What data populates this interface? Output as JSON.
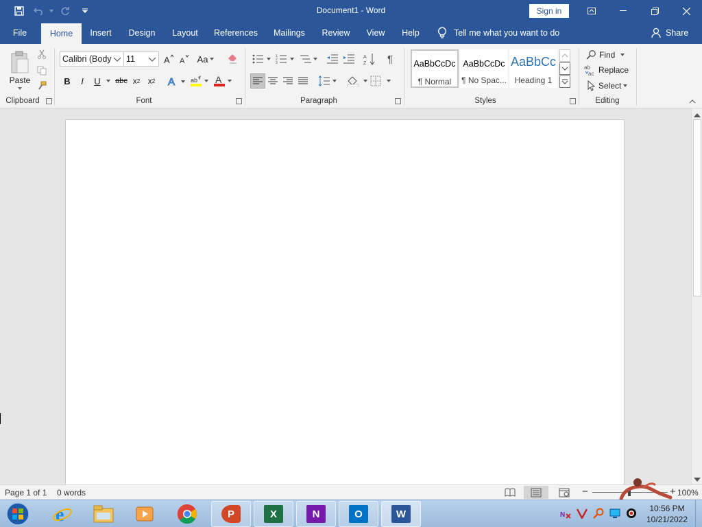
{
  "window": {
    "title": "Document1  -  Word",
    "sign_in": "Sign in"
  },
  "tabs": [
    "File",
    "Home",
    "Insert",
    "Design",
    "Layout",
    "References",
    "Mailings",
    "Review",
    "View",
    "Help"
  ],
  "tell_me": "Tell me what you want to do",
  "share": "Share",
  "clipboard": {
    "label": "Clipboard",
    "paste": "Paste"
  },
  "font": {
    "label": "Font",
    "name": "Calibri (Body",
    "size": "11",
    "change_case": "Aa",
    "strikethrough": "abc"
  },
  "paragraph": {
    "label": "Paragraph"
  },
  "styles": {
    "label": "Styles",
    "items": [
      {
        "sample": "AaBbCcDc",
        "name": "¶ Normal"
      },
      {
        "sample": "AaBbCcDc",
        "name": "¶ No Spac..."
      },
      {
        "sample": "AaBbCc",
        "name": "Heading 1"
      }
    ]
  },
  "editing": {
    "label": "Editing",
    "find": "Find",
    "replace": "Replace",
    "select": "Select"
  },
  "status": {
    "page": "Page 1 of 1",
    "words": "0 words",
    "zoom": "100%"
  },
  "taskbar": {
    "apps": [
      "start-orb",
      "internet-explorer",
      "file-explorer",
      "media-player",
      "chrome",
      "powerpoint",
      "excel",
      "onenote",
      "outlook",
      "word"
    ],
    "time": "10:56 PM",
    "date": "10/21/2022"
  },
  "colors": {
    "accent": "#2b579a",
    "ribbon": "#f3f3f3",
    "canvas": "#e6e6e6"
  }
}
